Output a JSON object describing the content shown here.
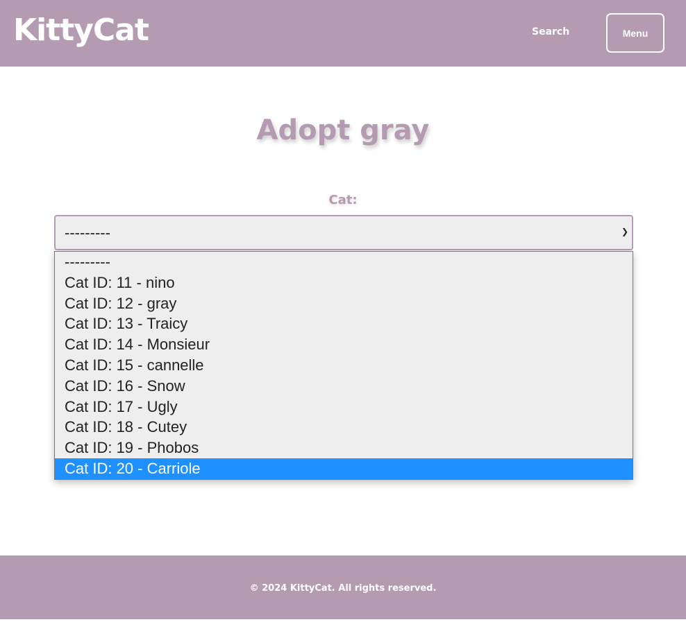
{
  "header": {
    "logo": "KittyCat",
    "search_label": "Search",
    "menu_label": "Menu"
  },
  "page": {
    "title": "Adopt gray",
    "cat_label": "Cat:"
  },
  "select": {
    "value": "---------",
    "options": [
      "---------",
      "Cat ID: 11 - nino",
      "Cat ID: 12 - gray",
      "Cat ID: 13 - Traicy",
      "Cat ID: 14 - Monsieur",
      "Cat ID: 15 - cannelle",
      "Cat ID: 16 - Snow",
      "Cat ID: 17 - Ugly",
      "Cat ID: 18 - Cutey",
      "Cat ID: 19 - Phobos",
      "Cat ID: 20 - Carriole"
    ],
    "highlighted": "Cat ID: 20 - Carriole"
  },
  "footer": {
    "text": "© 2024 KittyCat. All rights reserved."
  },
  "colors": {
    "brand": "#b49bb1",
    "highlight": "#1e90ff"
  }
}
